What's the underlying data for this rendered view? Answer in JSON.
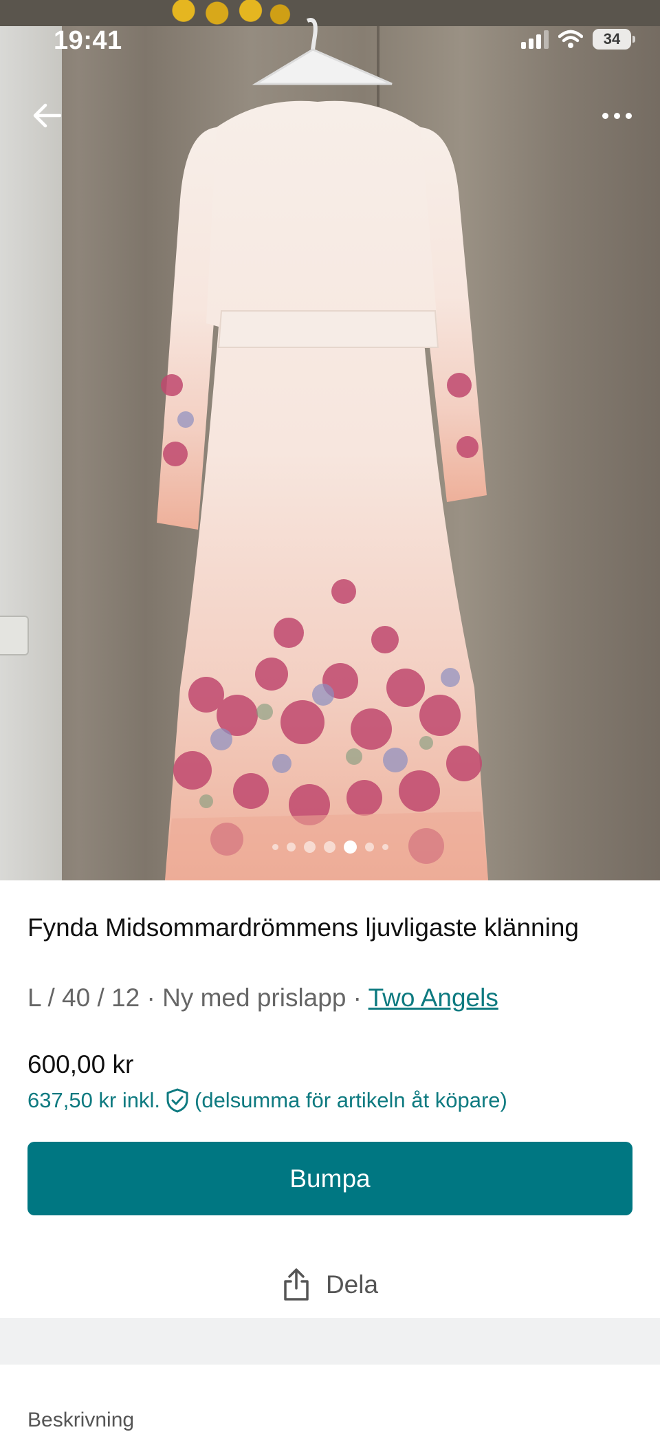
{
  "status_bar": {
    "time": "19:41",
    "battery": "34",
    "icons": [
      "cellular-signal-icon",
      "wifi-icon",
      "battery-icon"
    ]
  },
  "header": {
    "icons": [
      "arrow-left-icon",
      "more-horizontal-icon"
    ]
  },
  "gallery": {
    "image": "floral-dress-photo",
    "page_count": 7,
    "active_index": 4
  },
  "item": {
    "title": "Fynda Midsommardrömmens ljuvligaste klänning",
    "meta_prefix": "L / 40 / 12 · Ny med prislapp · ",
    "brand": "Two Angels",
    "price": "600,00 kr",
    "price_incl": "637,50 kr inkl.",
    "price_incl_note": "(delsumma för artikeln åt köpare)",
    "protection_icon": "shield-check-icon"
  },
  "actions": {
    "bump_label": "Bumpa",
    "share_label": "Dela",
    "share_icon": "share-icon"
  },
  "description": {
    "label": "Beskrivning"
  },
  "colors": {
    "accent": "#007782",
    "link": "#0e7a80",
    "muted_text": "#666666",
    "band": "#f0f1f2"
  }
}
